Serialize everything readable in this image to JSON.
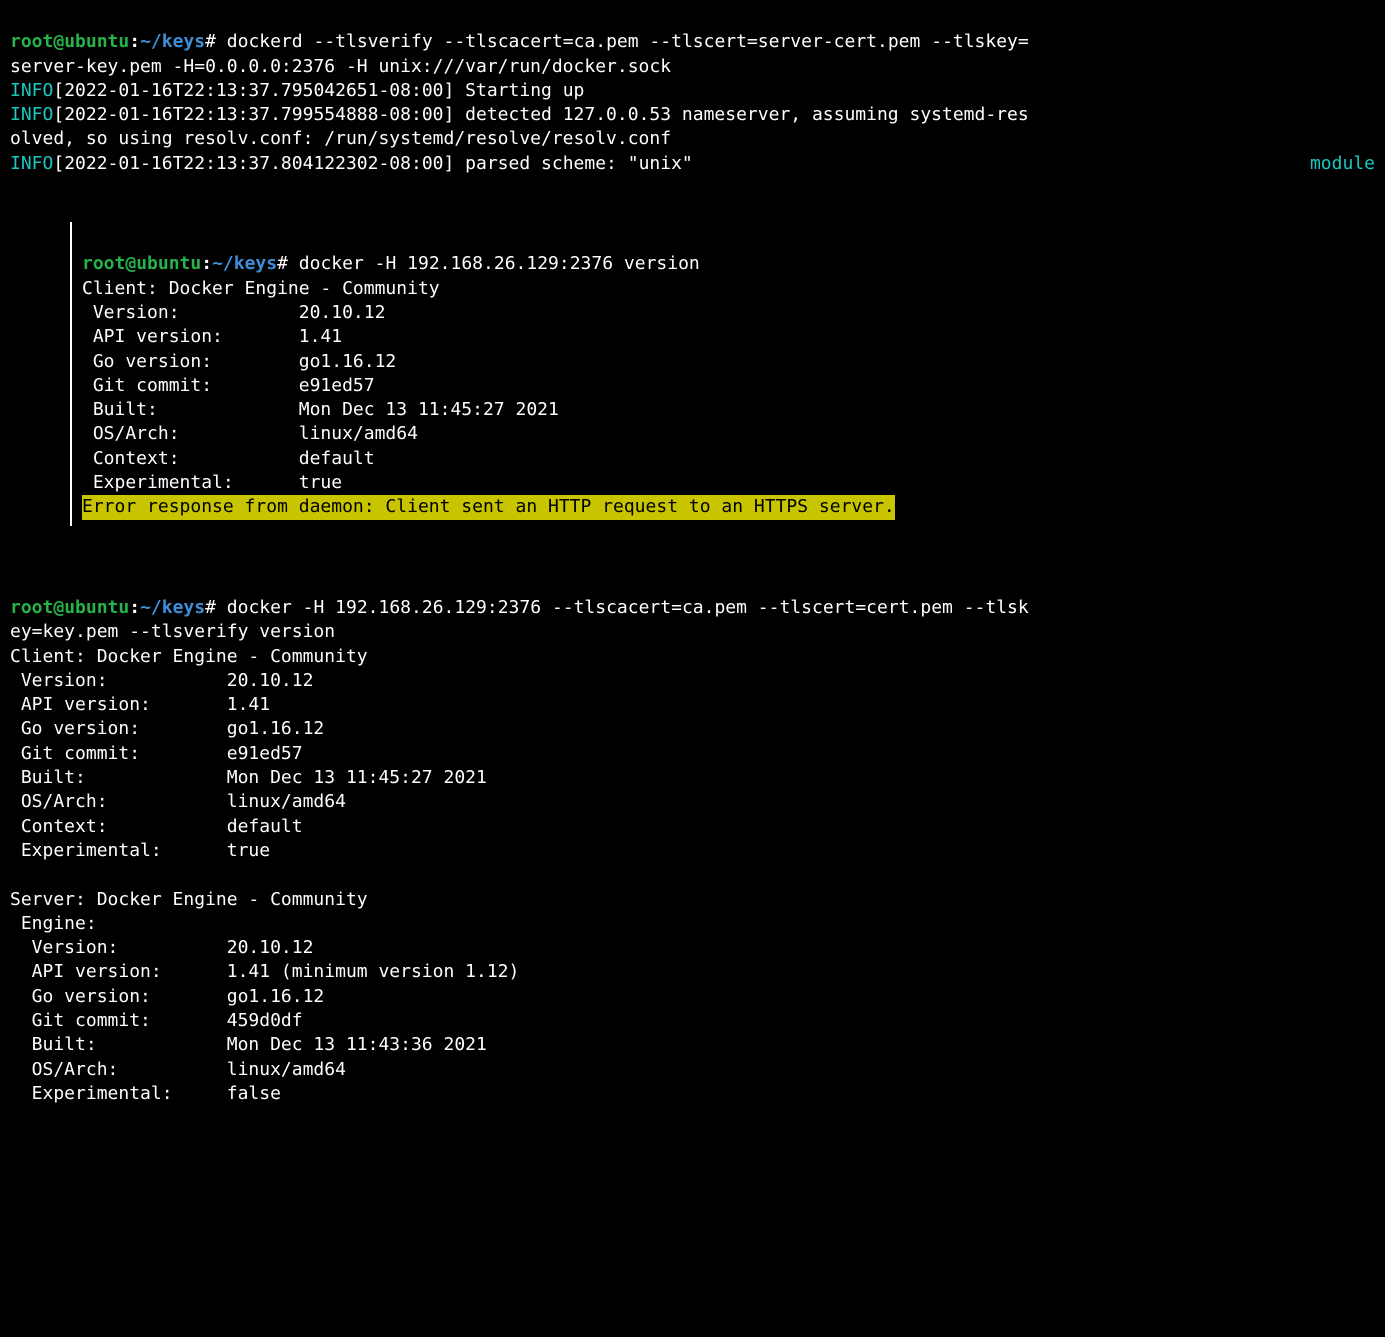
{
  "prompt": {
    "user": "root",
    "at": "@",
    "host": "ubuntu",
    "colon": ":",
    "path": "~/keys",
    "hash": "#"
  },
  "block1": {
    "cmd_l1": " dockerd --tlsverify --tlscacert=ca.pem --tlscert=server-cert.pem --tlskey=",
    "cmd_l2": "server-key.pem -H=0.0.0.0:2376 -H unix:///var/run/docker.sock",
    "info1_label": "INFO",
    "info1_ts": "[2022-01-16T22:13:37.795042651-08:00] ",
    "info1_msg": "Starting up",
    "info2_label": "INFO",
    "info2_ts": "[2022-01-16T22:13:37.799554888-08:00] ",
    "info2_msg": "detected 127.0.0.53 nameserver, assuming systemd-res",
    "info2_cont": "olved, so using resolv.conf: /run/systemd/resolve/resolv.conf",
    "info3_label": "INFO",
    "info3_ts": "[2022-01-16T22:13:37.804122302-08:00] ",
    "info3_msg": "parsed scheme: \"unix\"",
    "module": "module"
  },
  "block2": {
    "cmd": " docker -H 192.168.26.129:2376 version",
    "client_hdr": "Client: Docker Engine - Community",
    "rows": {
      "version": " Version:           20.10.12",
      "api": " API version:       1.41",
      "go": " Go version:        go1.16.12",
      "git": " Git commit:        e91ed57",
      "built": " Built:             Mon Dec 13 11:45:27 2021",
      "osarch": " OS/Arch:           linux/amd64",
      "context": " Context:           default",
      "experimental": " Experimental:      true"
    },
    "error": "Error response from daemon: Client sent an HTTP request to an HTTPS server."
  },
  "block3": {
    "cmd_l1": " docker -H 192.168.26.129:2376 --tlscacert=ca.pem --tlscert=cert.pem --tlsk",
    "cmd_l2": "ey=key.pem --tlsverify version",
    "client_hdr": "Client: Docker Engine - Community",
    "client": {
      "version": " Version:           20.10.12",
      "api": " API version:       1.41",
      "go": " Go version:        go1.16.12",
      "git": " Git commit:        e91ed57",
      "built": " Built:             Mon Dec 13 11:45:27 2021",
      "osarch": " OS/Arch:           linux/amd64",
      "context": " Context:           default",
      "experimental": " Experimental:      true"
    },
    "server_hdr": "Server: Docker Engine - Community",
    "engine_hdr": " Engine:",
    "server": {
      "version": "  Version:          20.10.12",
      "api": "  API version:      1.41 (minimum version 1.12)",
      "go": "  Go version:       go1.16.12",
      "git": "  Git commit:       459d0df",
      "built": "  Built:            Mon Dec 13 11:43:36 2021",
      "osarch": "  OS/Arch:          linux/amd64",
      "experimental": "  Experimental:     false"
    }
  }
}
